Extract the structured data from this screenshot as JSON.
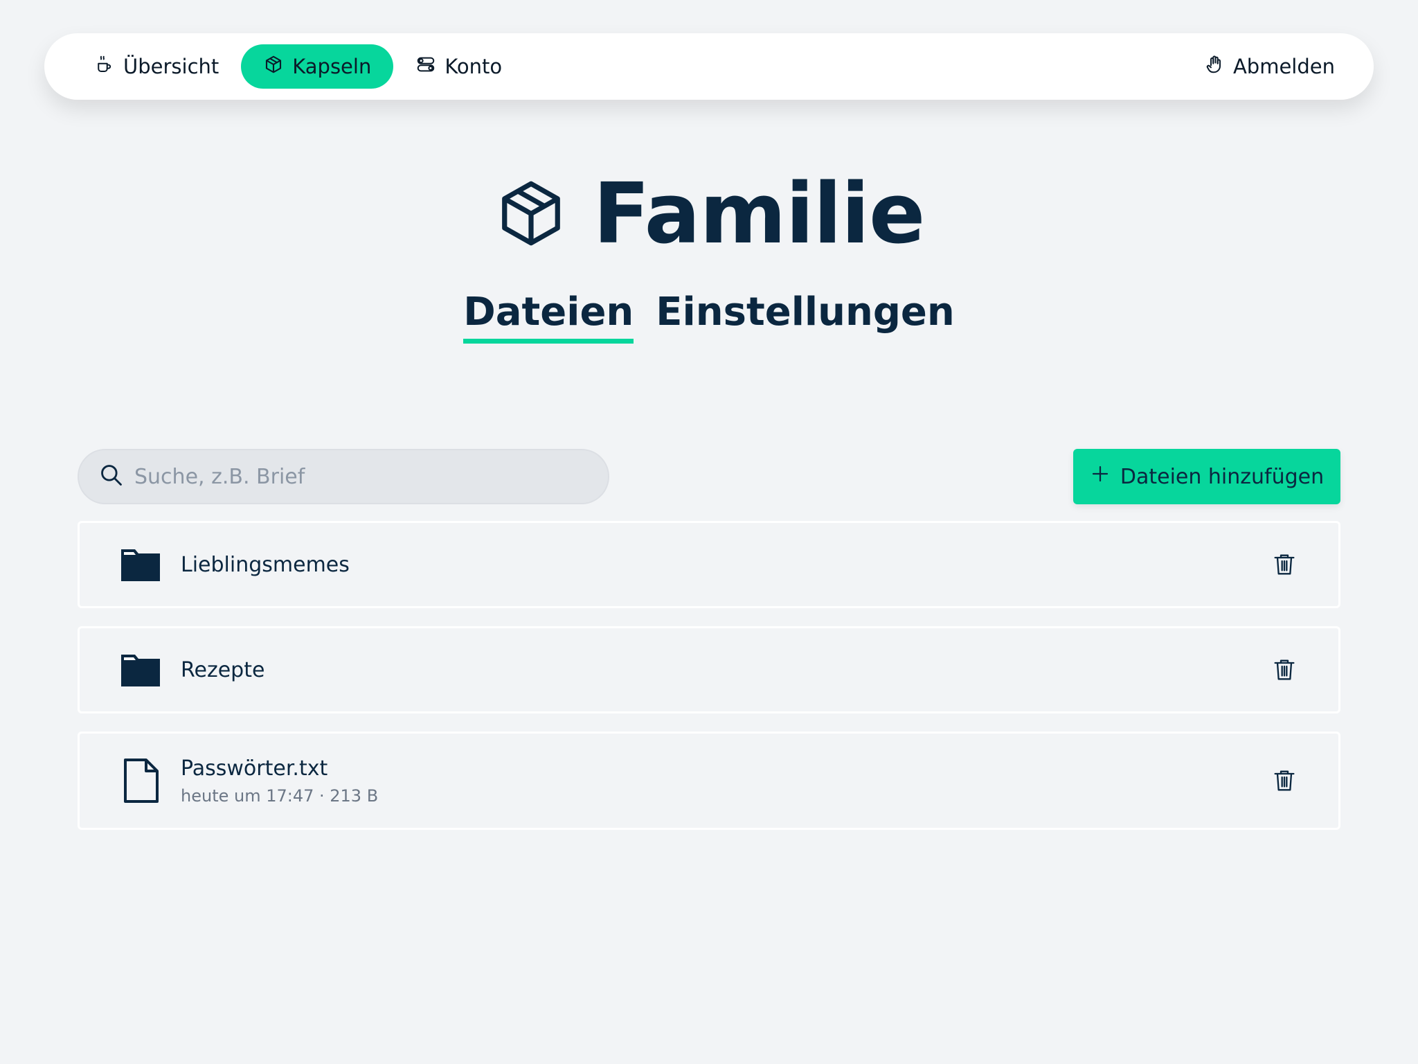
{
  "nav": {
    "items": [
      {
        "label": "Übersicht",
        "icon": "coffee-cup-icon",
        "active": false
      },
      {
        "label": "Kapseln",
        "icon": "cube-icon",
        "active": true
      },
      {
        "label": "Konto",
        "icon": "toggles-icon",
        "active": false
      }
    ],
    "logout": {
      "label": "Abmelden",
      "icon": "hand-icon"
    }
  },
  "page": {
    "title": "Familie",
    "title_icon": "cube-icon"
  },
  "tabs": [
    {
      "label": "Dateien",
      "active": true
    },
    {
      "label": "Einstellungen",
      "active": false
    }
  ],
  "search": {
    "placeholder": "Suche, z.B. Brief",
    "value": ""
  },
  "toolbar": {
    "add_label": "Dateien hinzufügen"
  },
  "files": [
    {
      "name": "Lieblingsmemes",
      "type": "folder",
      "meta": ""
    },
    {
      "name": "Rezepte",
      "type": "folder",
      "meta": ""
    },
    {
      "name": "Passwörter.txt",
      "type": "file",
      "meta": "heute um 17:47 · 213 B"
    }
  ],
  "colors": {
    "accent": "#07d69c",
    "text": "#0b2740",
    "background": "#f2f4f6"
  }
}
